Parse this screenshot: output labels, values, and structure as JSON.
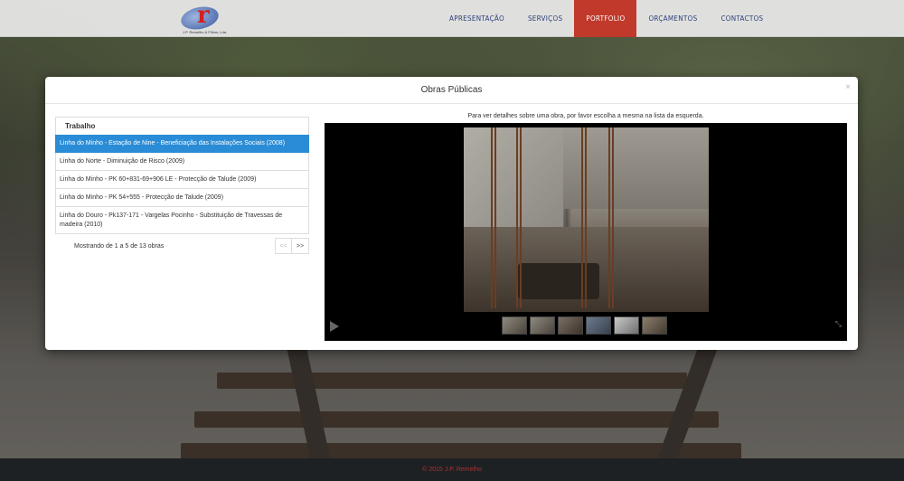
{
  "logo": {
    "alt": "IP Remelho logo",
    "subtitle": "J.P. Remelho & Filhos, Lda."
  },
  "nav": {
    "items": [
      {
        "label": "APRESENTAÇÃO"
      },
      {
        "label": "SERVIÇOS"
      },
      {
        "label": "PORTFOLIO",
        "active": true
      },
      {
        "label": "ORÇAMENTOS"
      },
      {
        "label": "CONTACTOS"
      }
    ]
  },
  "modal": {
    "title": "Obras Públicas",
    "close_icon": "×",
    "list": {
      "header": "Trabalho",
      "items": [
        {
          "label": "Linha do Minho - Estação de Nine - Beneficiação das Instalações Sociais (2008)",
          "active": true
        },
        {
          "label": "Linha do Norte - Diminuição de Risco (2009)"
        },
        {
          "label": "Linha do Minho - PK 60+831-69+906 LE - Protecção de Talude (2009)"
        },
        {
          "label": "Linha do Minho - PK 54+555 - Protecção de Talude (2009)"
        },
        {
          "label": "Linha do Douro - Pk137-171 - Vargelas Pocinho - Substituição de Travessas de madeira (2010)"
        }
      ],
      "count_text": "Mostrando de 1 a 5 de 13 obras",
      "prev": "<<",
      "next": ">>"
    },
    "hint": "Para ver detalhes sobre uma obra, por favor escolha a mesma na lista da esquerda.",
    "gallery": {
      "play_icon": "play-icon",
      "fullscreen_icon": "fullscreen-icon",
      "thumbnail_count": 6
    }
  },
  "footer": {
    "text": "© 2015 J.P. Remelho"
  },
  "colors": {
    "nav_active": "#c0392b",
    "nav_text": "#2d3e7a",
    "list_active": "#2a8cd6",
    "footer_bg": "#1d2124"
  }
}
